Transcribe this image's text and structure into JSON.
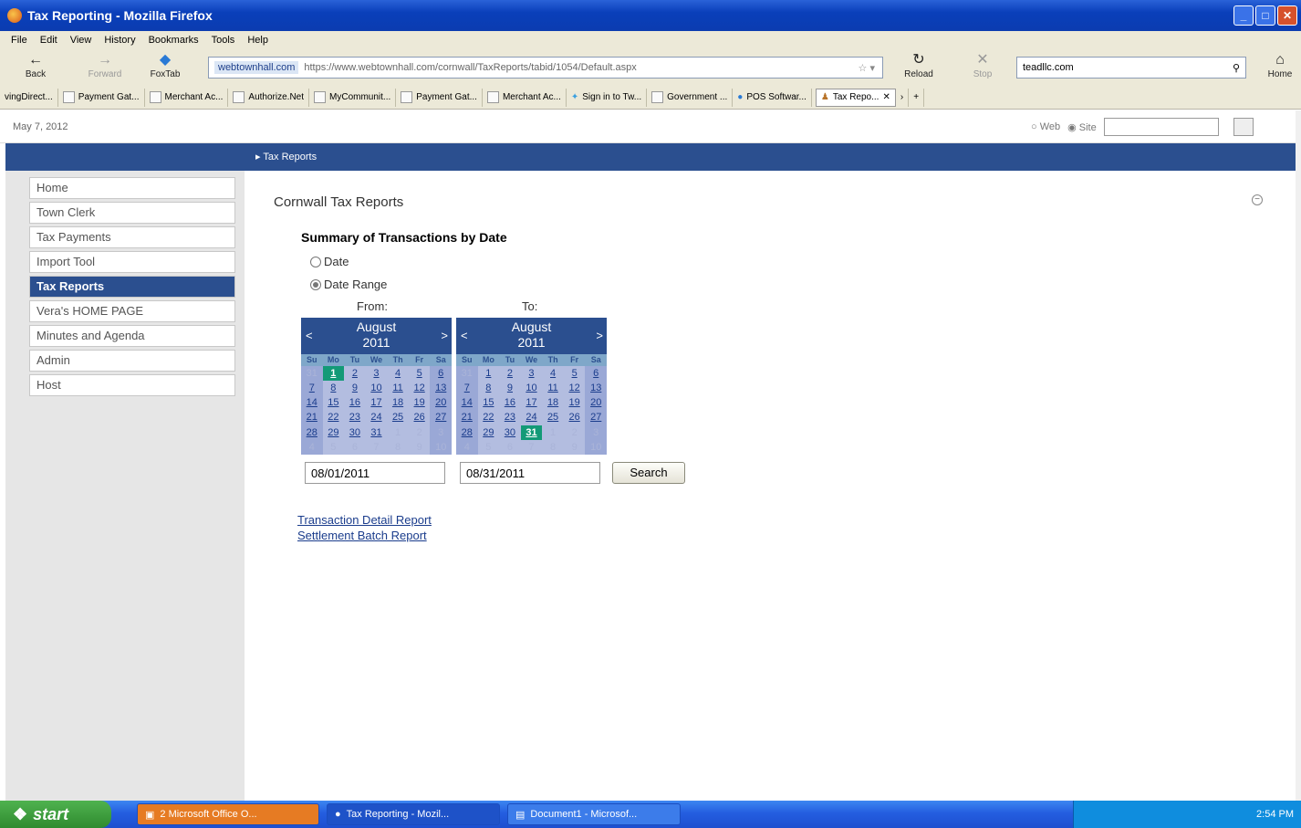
{
  "window": {
    "title": "Tax Reporting - Mozilla Firefox"
  },
  "menu": [
    "File",
    "Edit",
    "View",
    "History",
    "Bookmarks",
    "Tools",
    "Help"
  ],
  "nav": {
    "back": "Back",
    "forward": "Forward",
    "foxtab": "FoxTab",
    "reload": "Reload",
    "stop": "Stop",
    "home": "Home"
  },
  "url": {
    "site": "webtownhall.com",
    "address": "https://www.webtownhall.com/cornwall/TaxReports/tabid/1054/Default.aspx"
  },
  "search_engine": {
    "value": "teadllc.com"
  },
  "bookmarks": [
    "vingDirect...",
    "Payment Gat...",
    "Merchant Ac...",
    "Authorize.Net",
    "MyCommunit...",
    "Payment Gat...",
    "Merchant Ac...",
    "Sign in to Tw...",
    "Government ...",
    "POS Softwar..."
  ],
  "active_tab": "Tax Repo...",
  "page_date": "May 7, 2012",
  "site_search": {
    "web": "Web",
    "site": "Site"
  },
  "breadcrumb": "Tax Reports",
  "sidebar": [
    "Home",
    "Town Clerk",
    "Tax Payments",
    "Import Tool",
    "Tax Reports",
    "Vera's HOME PAGE",
    "Minutes and Agenda",
    "Admin",
    "Host"
  ],
  "main": {
    "title": "Cornwall Tax Reports",
    "section_title": "Summary of Transactions by Date",
    "radio_date": "Date",
    "radio_range": "Date Range",
    "from_label": "From:",
    "to_label": "To:",
    "from_value": "08/01/2011",
    "to_value": "08/31/2011",
    "search_label": "Search",
    "link_detail": "Transaction Detail Report",
    "link_settlement": "Settlement Batch Report"
  },
  "calendar": {
    "month": "August",
    "year": "2011",
    "prev": "<",
    "next": ">",
    "days_of_week": [
      "Su",
      "Mo",
      "Tu",
      "We",
      "Th",
      "Fr",
      "Sa"
    ],
    "weeks": [
      [
        "31",
        "1",
        "2",
        "3",
        "4",
        "5",
        "6"
      ],
      [
        "7",
        "8",
        "9",
        "10",
        "11",
        "12",
        "13"
      ],
      [
        "14",
        "15",
        "16",
        "17",
        "18",
        "19",
        "20"
      ],
      [
        "21",
        "22",
        "23",
        "24",
        "25",
        "26",
        "27"
      ],
      [
        "28",
        "29",
        "30",
        "31",
        "1",
        "2",
        "3"
      ],
      [
        "4",
        "5",
        "6",
        "7",
        "8",
        "9",
        "10"
      ]
    ],
    "from_selected": "1",
    "to_selected": "31"
  },
  "taskbar": {
    "start": "start",
    "tasks": [
      "2 Microsoft Office O...",
      "Tax Reporting - Mozil...",
      "Document1 - Microsof..."
    ],
    "clock": "2:54 PM"
  }
}
